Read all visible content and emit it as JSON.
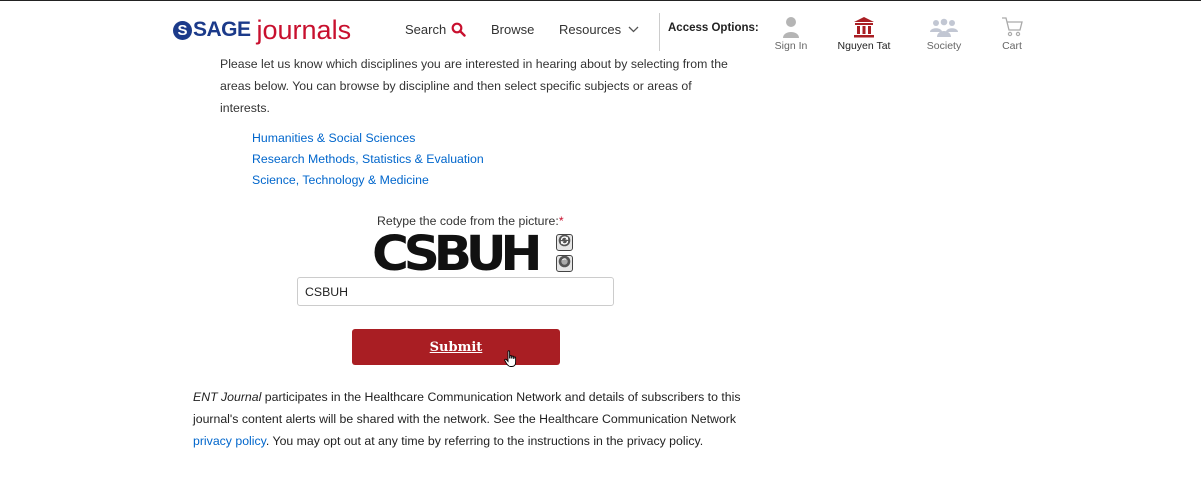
{
  "header": {
    "logo_mark": "S",
    "logo_sage": "SAGE",
    "logo_journals": "journals",
    "nav": {
      "search": "Search",
      "browse": "Browse",
      "resources": "Resources"
    },
    "access_options": "Access Options:",
    "access_items": {
      "sign_in": "Sign In",
      "institution": "Nguyen Tat",
      "society": "Society",
      "cart": "Cart"
    },
    "colors": {
      "brand_blue": "#1b3a8a",
      "brand_red": "#c8102e",
      "institution_red": "#a91e23",
      "muted_icon": "#999999"
    },
    "icons": [
      "search-icon",
      "chevron-down-icon",
      "person-icon",
      "institution-icon",
      "society-icon",
      "cart-icon"
    ]
  },
  "main": {
    "intro": "Please let us know which disciplines you are interested in hearing about by selecting from the areas below. You can browse by discipline and then select specific subjects or areas of interests.",
    "disciplines": [
      "Humanities & Social Sciences",
      "Research Methods, Statistics & Evaluation",
      "Science, Technology & Medicine"
    ],
    "captcha": {
      "label": "Retype the code from the picture:",
      "required_mark": "*",
      "image_text": "CSBUH",
      "input_value": "CSBUH",
      "icons": [
        "refresh-icon",
        "audio-icon"
      ]
    },
    "submit_label": "Submit",
    "submit_color": "#a91e23"
  },
  "footer": {
    "journal_name": "ENT Journal",
    "text_before_link": " participates in the Healthcare Communication Network and details of subscribers to this journal's content alerts will be shared with the network. See the Healthcare Communication Network ",
    "link_text": "privacy policy",
    "text_after_link": ". You may opt out at any time by referring to the instructions in the privacy policy."
  }
}
